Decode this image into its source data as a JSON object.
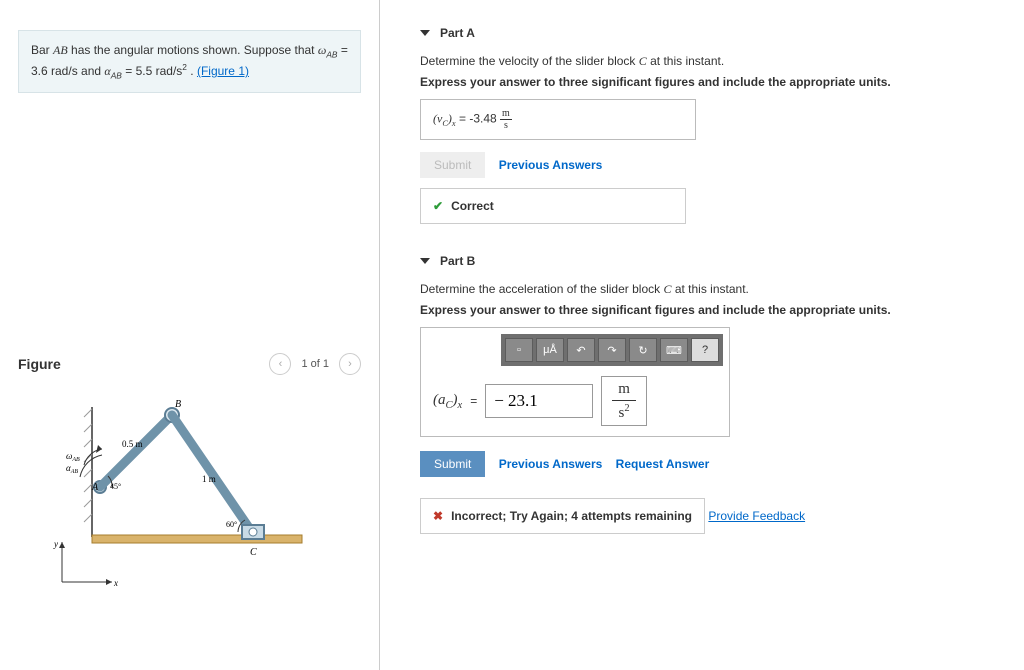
{
  "problem": {
    "text_pre": "Bar ",
    "bar": "AB",
    "text_mid": " has the angular motions shown. Suppose that ",
    "omega_sym": "ω",
    "omega_sub": "AB",
    "omega_eq": " = 3.6 rad/s",
    "and": " and ",
    "alpha_sym": "α",
    "alpha_sub": "AB",
    "alpha_eq": " = 5.5 rad/s",
    "alpha_exp": "2",
    "period": " . ",
    "fig_link": "(Figure 1)"
  },
  "figure": {
    "title": "Figure",
    "page": "1 of 1",
    "labels": {
      "A": "A",
      "B": "B",
      "C": "C",
      "len1": "0.5 m",
      "len2": "1 m",
      "ang1": "45°",
      "ang2": "60°",
      "omega": "ω",
      "alpha": "α",
      "sub": "AB",
      "x": "x",
      "y": "y"
    }
  },
  "partA": {
    "title": "Part A",
    "prompt_pre": "Determine the velocity of the slider block ",
    "prompt_var": "C",
    "prompt_post": " at this instant.",
    "instruct": "Express your answer to three significant figures and include the appropriate units.",
    "ans_sym_pre": "(v",
    "ans_sym_sub": "C",
    "ans_sym_post": ")",
    "ans_sym_sub2": "x",
    "ans_eq": " = ",
    "ans_val": "-3.48",
    "ans_unit_n": "m",
    "ans_unit_d": "s",
    "submit": "Submit",
    "prev": "Previous Answers",
    "feedback": "Correct"
  },
  "partB": {
    "title": "Part B",
    "prompt_pre": "Determine the acceleration of the slider block ",
    "prompt_var": "C",
    "prompt_post": " at this instant.",
    "instruct": "Express your answer to three significant figures and include the appropriate units.",
    "toolbar": {
      "t1": "▫",
      "t2": "μÅ",
      "t3": "↶",
      "t4": "↷",
      "t5": "↻",
      "t6": "⌨",
      "t7": "?"
    },
    "ans_sym_pre": "(a",
    "ans_sym_sub": "C",
    "ans_sym_post": ")",
    "ans_sym_sub2": "x",
    "ans_eq": " = ",
    "ans_val": "− 23.1",
    "unit_n": "m",
    "unit_d": "s",
    "unit_exp": "2",
    "submit": "Submit",
    "prev": "Previous Answers",
    "req": "Request Answer",
    "feedback": "Incorrect; Try Again; 4 attempts remaining"
  },
  "footer": {
    "provide": "Provide Feedback"
  }
}
